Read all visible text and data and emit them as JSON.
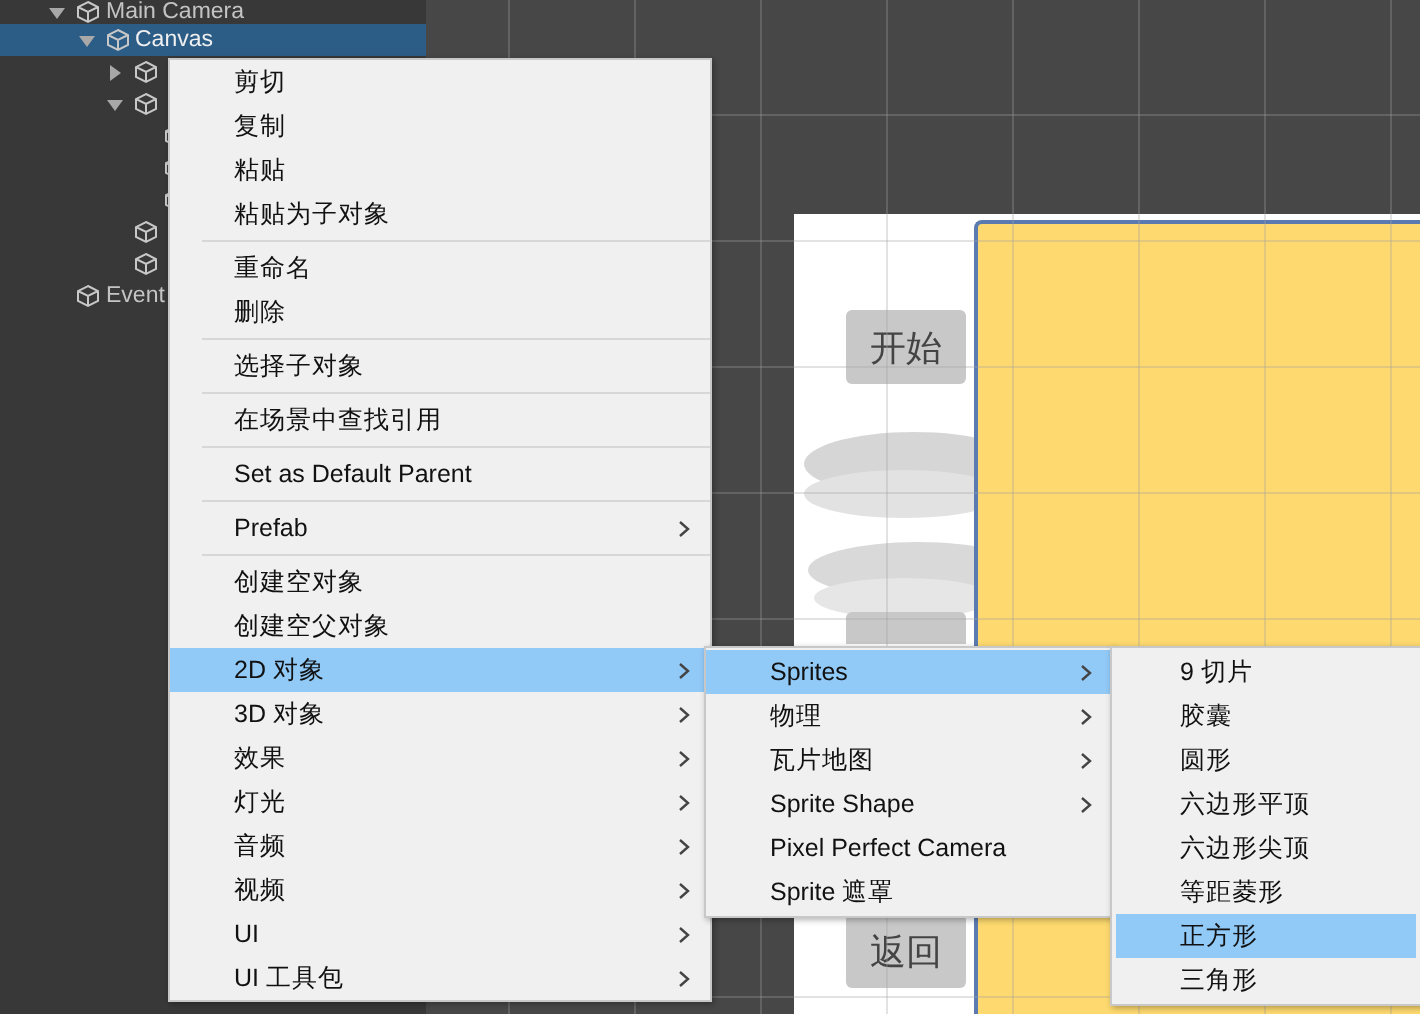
{
  "hierarchy": {
    "items": [
      {
        "label": "Main Camera",
        "expanded": true,
        "selected": false,
        "children": [
          {
            "label": "Canvas",
            "expanded": true,
            "selected": true,
            "children": [
              {
                "expanded": false,
                "selected": false
              },
              {
                "expanded": true,
                "selected": false,
                "children": [
                  {
                    "selected": false
                  },
                  {
                    "selected": false
                  },
                  {
                    "selected": false
                  }
                ]
              },
              {
                "selected": false
              },
              {
                "selected": false
              }
            ]
          }
        ]
      },
      {
        "label": "Event",
        "selected": false
      }
    ]
  },
  "game_view": {
    "buttons": [
      "开始",
      "返回"
    ]
  },
  "context_menu": {
    "groups": [
      [
        {
          "label": "剪切",
          "submenu": false,
          "selected": false
        },
        {
          "label": "复制",
          "submenu": false,
          "selected": false
        },
        {
          "label": "粘贴",
          "submenu": false,
          "selected": false
        },
        {
          "label": "粘贴为子对象",
          "submenu": false,
          "selected": false
        }
      ],
      [
        {
          "label": "重命名",
          "submenu": false,
          "selected": false
        },
        {
          "label": "删除",
          "submenu": false,
          "selected": false
        }
      ],
      [
        {
          "label": "选择子对象",
          "submenu": false,
          "selected": false
        }
      ],
      [
        {
          "label": "在场景中查找引用",
          "submenu": false,
          "selected": false
        }
      ],
      [
        {
          "label": "Set as Default Parent",
          "submenu": false,
          "selected": false
        }
      ],
      [
        {
          "label": "Prefab",
          "submenu": true,
          "selected": false
        }
      ],
      [
        {
          "label": "创建空对象",
          "submenu": false,
          "selected": false
        },
        {
          "label": "创建空父对象",
          "submenu": false,
          "selected": false
        },
        {
          "label": "2D 对象",
          "submenu": true,
          "selected": true
        },
        {
          "label": "3D 对象",
          "submenu": true,
          "selected": false
        },
        {
          "label": "效果",
          "submenu": true,
          "selected": false
        },
        {
          "label": "灯光",
          "submenu": true,
          "selected": false
        },
        {
          "label": "音频",
          "submenu": true,
          "selected": false
        },
        {
          "label": "视频",
          "submenu": true,
          "selected": false
        },
        {
          "label": "UI",
          "submenu": true,
          "selected": false
        },
        {
          "label": "UI 工具包",
          "submenu": true,
          "selected": false
        }
      ]
    ]
  },
  "submenu_2d": {
    "items": [
      {
        "label": "Sprites",
        "submenu": true,
        "selected": true
      },
      {
        "label": "物理",
        "submenu": true,
        "selected": false
      },
      {
        "label": "瓦片地图",
        "submenu": true,
        "selected": false
      },
      {
        "label": "Sprite Shape",
        "submenu": true,
        "selected": false
      },
      {
        "label": "Pixel Perfect Camera",
        "submenu": false,
        "selected": false
      },
      {
        "label": "Sprite 遮罩",
        "submenu": false,
        "selected": false
      }
    ]
  },
  "submenu_sprites": {
    "items": [
      {
        "label": "9 切片",
        "submenu": false,
        "selected": false
      },
      {
        "label": "胶囊",
        "submenu": false,
        "selected": false
      },
      {
        "label": "圆形",
        "submenu": false,
        "selected": false
      },
      {
        "label": "六边形平顶",
        "submenu": false,
        "selected": false
      },
      {
        "label": "六边形尖顶",
        "submenu": false,
        "selected": false
      },
      {
        "label": "等距菱形",
        "submenu": false,
        "selected": false
      },
      {
        "label": "正方形",
        "submenu": false,
        "selected": true
      },
      {
        "label": "三角形",
        "submenu": false,
        "selected": false
      }
    ]
  }
}
